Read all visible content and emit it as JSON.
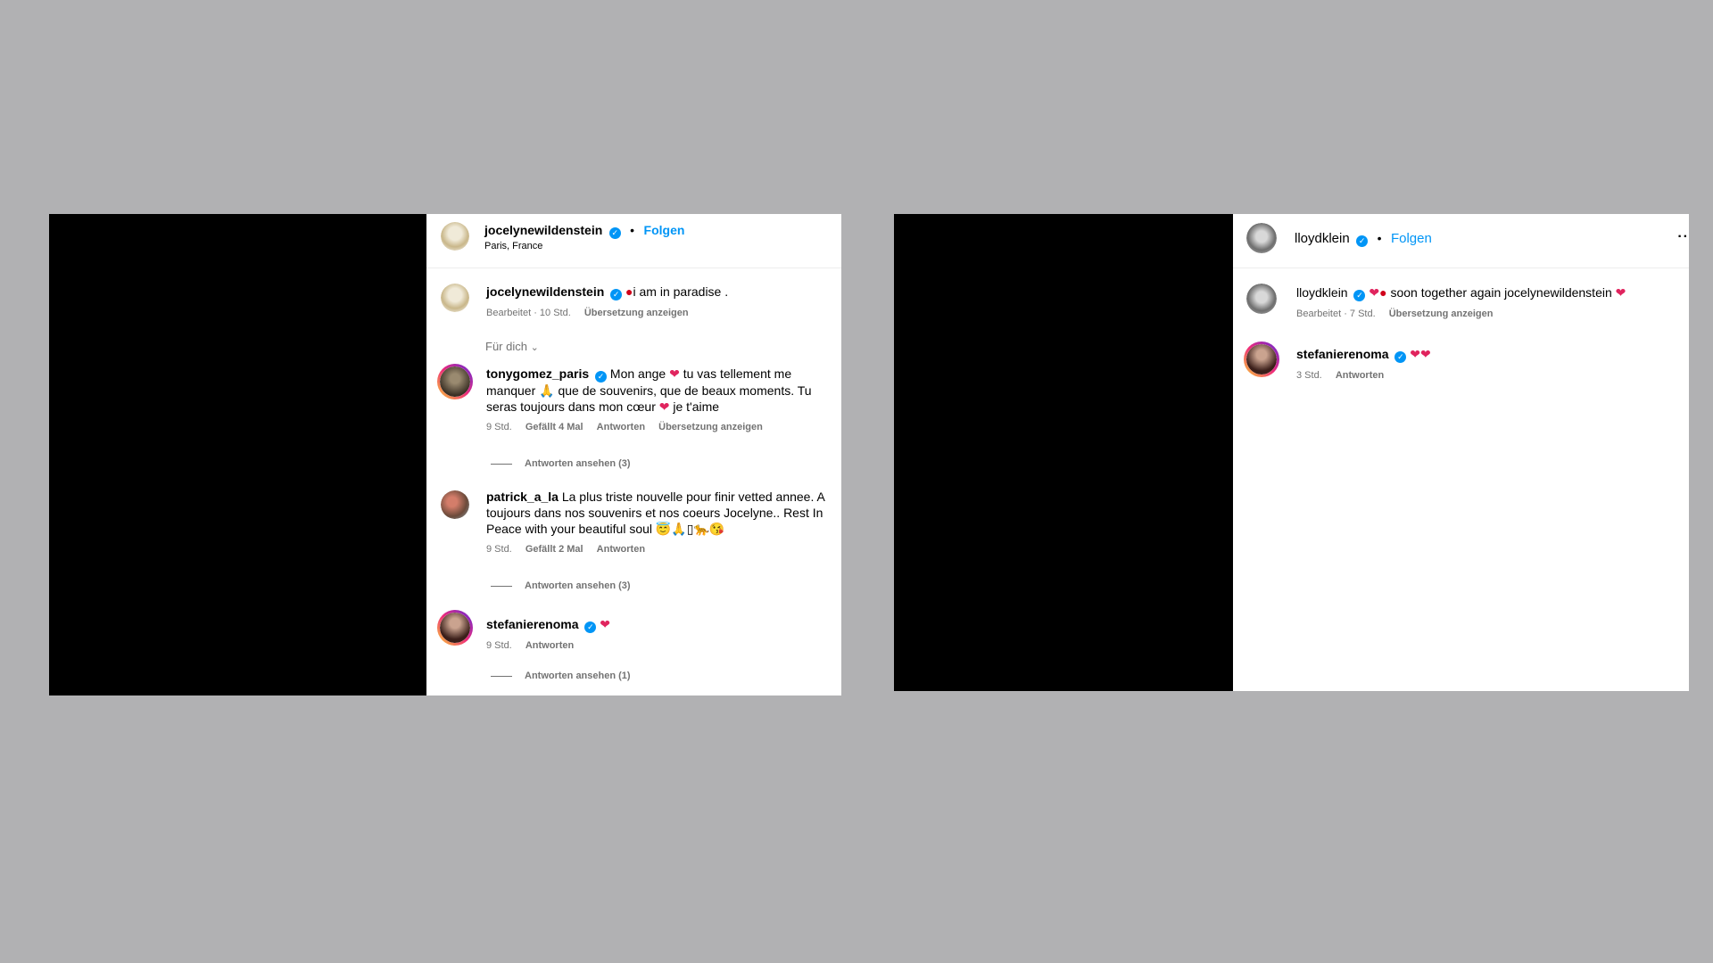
{
  "left_post": {
    "header": {
      "username": "jocelynewildenstein",
      "follow_label": "Folgen",
      "location": "Paris, France"
    },
    "caption": {
      "username": "jocelynewildenstein",
      "text": "i am in paradise .",
      "edited": "Bearbeitet · 10 Std.",
      "translate_label": "Übersetzung anzeigen"
    },
    "filter_label": "Für dich",
    "comments": [
      {
        "username": "tonygomez_paris",
        "text_1": "Mon ange",
        "text_2": "tu vas tellement me manquer",
        "text_3": "que de souvenirs, que de beaux moments. Tu seras toujours dans mon cœur",
        "text_4": "je t'aime",
        "time": "9 Std.",
        "likes": "Gefällt 4 Mal",
        "reply_label": "Antworten",
        "translate_label": "Übersetzung anzeigen",
        "view_replies": "Antworten ansehen (3)"
      },
      {
        "username": "patrick_a_la",
        "text": "La plus triste nouvelle pour finir vetted annee. A toujours dans nos souvenirs et nos coeurs Jocelyne.. Rest In Peace with your beautiful soul",
        "emojis": "😇🙏▯🐆😘",
        "time": "9 Std.",
        "likes": "Gefällt 2 Mal",
        "reply_label": "Antworten",
        "view_replies": "Antworten ansehen (3)"
      },
      {
        "username": "stefanierenoma",
        "time": "9 Std.",
        "reply_label": "Antworten",
        "view_replies": "Antworten ansehen (1)"
      }
    ]
  },
  "right_post": {
    "header": {
      "username": "lloydklein",
      "follow_label": "Folgen",
      "more": "··"
    },
    "caption": {
      "username": "lloydklein",
      "text": "soon together again jocelynewildenstein",
      "edited": "Bearbeitet · 7 Std.",
      "translate_label": "Übersetzung anzeigen"
    },
    "comments": [
      {
        "username": "stefanierenoma",
        "time": "3 Std.",
        "reply_label": "Antworten"
      }
    ]
  },
  "icons": {
    "heart": "❤",
    "drop": "🩸",
    "pray": "🙏",
    "check": "✓"
  },
  "colors": {
    "background": "#b1b1b3",
    "accent": "#0095f6",
    "heart": "#e0245e"
  }
}
